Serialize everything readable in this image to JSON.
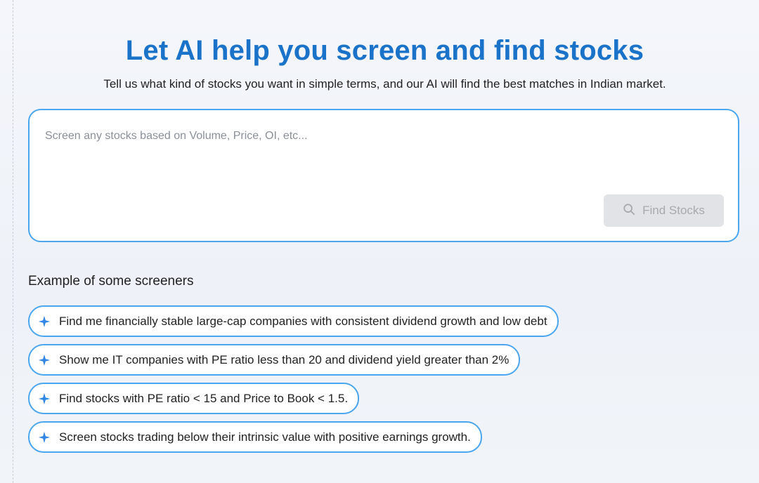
{
  "header": {
    "title": "Let AI help you screen and find stocks",
    "subtitle": "Tell us what kind of stocks you want in simple terms, and our AI will find the best matches in Indian market."
  },
  "query": {
    "placeholder": "Screen any stocks based on Volume, Price, OI, etc...",
    "value": "",
    "button_label": "Find Stocks",
    "button_icon": "search-icon"
  },
  "examples": {
    "heading": "Example of some screeners",
    "icon": "sparkle-icon",
    "items": [
      {
        "label": "Find me financially stable large-cap companies with consistent dividend growth and low debt"
      },
      {
        "label": "Show me IT companies with PE ratio less than 20 and dividend yield greater than 2%"
      },
      {
        "label": "Find stocks with PE ratio < 15 and Price to Book < 1.5."
      },
      {
        "label": "Screen stocks trading below their intrinsic value with positive earnings growth."
      }
    ]
  },
  "colors": {
    "accent": "#1a73c9",
    "border": "#4aa6ee",
    "sparkle": "#2f86e6",
    "button_bg_disabled": "#e2e3e6"
  }
}
